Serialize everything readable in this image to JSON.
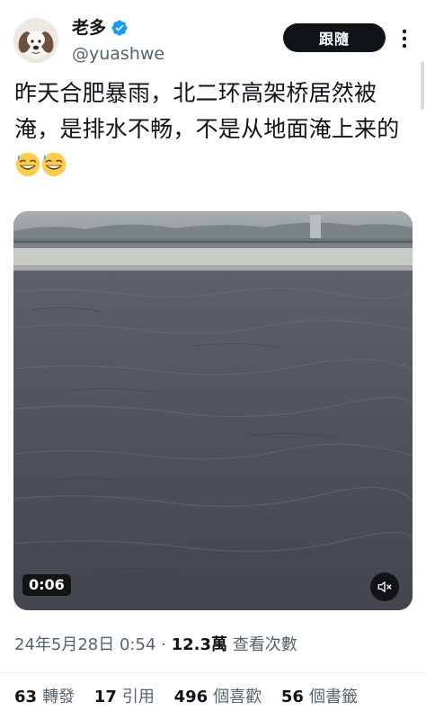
{
  "user": {
    "display_name": "老多",
    "handle": "@yuashwe",
    "verified": true,
    "avatar_icon": "dog-avatar-icon"
  },
  "header": {
    "follow_label": "跟隨",
    "more_icon": "more-vertical-icon"
  },
  "post": {
    "text": "昨天合肥暴雨，北二环高架桥居然被淹，是排水不畅，不是从地面淹上来的",
    "emojis": [
      "grinning-sweat-emoji",
      "grinning-sweat-emoji"
    ]
  },
  "video": {
    "duration": "0:06",
    "mute_icon": "speaker-muted-icon"
  },
  "meta": {
    "timestamp": "24年5月28日 0:54",
    "separator": "·",
    "views_count": "12.3萬",
    "views_label": "查看次數"
  },
  "stats": [
    {
      "count": "63",
      "label": "轉發"
    },
    {
      "count": "17",
      "label": "引用"
    },
    {
      "count": "496",
      "label": "個喜歡"
    },
    {
      "count": "56",
      "label": "個書籤"
    }
  ],
  "colors": {
    "text": "#0f1419",
    "secondary": "#536471",
    "verified": "#1d9bf0",
    "button": "#0f1419"
  }
}
